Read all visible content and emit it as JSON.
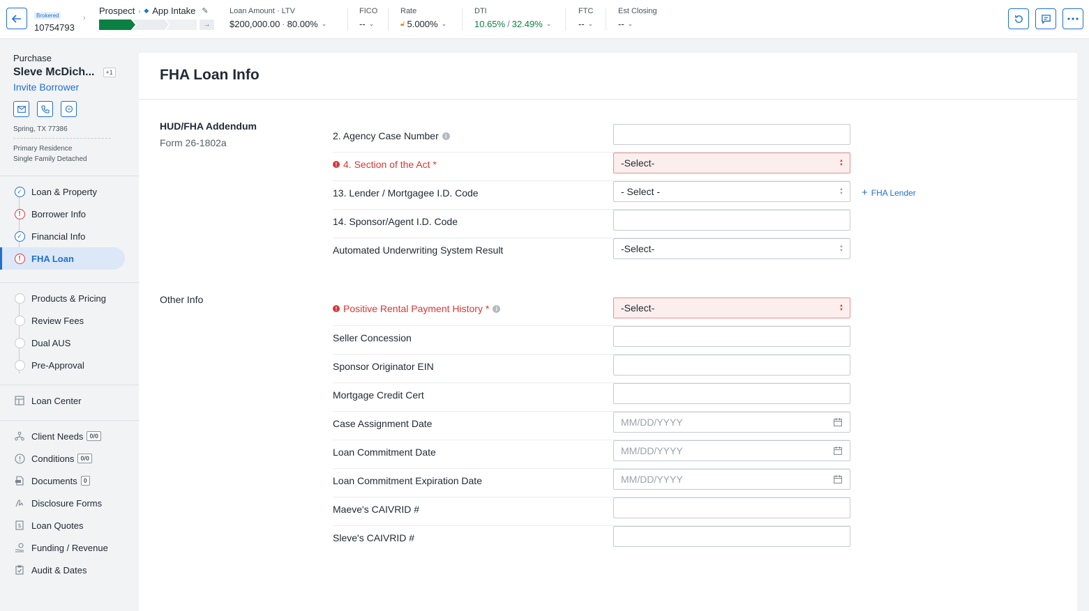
{
  "header": {
    "brokered_label": "Brokered",
    "loan_id": "10754793",
    "stage_prev": "Prospect",
    "stage_current": "App Intake",
    "metrics": {
      "loan_amount_label": "Loan Amount",
      "ltv_label": "LTV",
      "loan_amount": "$200,000.00",
      "ltv": "80.00%",
      "fico_label": "FICO",
      "fico": "--",
      "rate_label": "Rate",
      "rate": "5.000%",
      "dti_label": "DTI",
      "dti_front": "10.65%",
      "dti_back": "32.49%",
      "ftc_label": "FTC",
      "ftc": "--",
      "closing_label": "Est Closing",
      "closing": "--"
    },
    "actions": [
      "refresh-icon",
      "comment-icon",
      "more-icon"
    ],
    "colors": {
      "accent": "#1f6fd1",
      "success": "#0b8043",
      "error": "#d93636",
      "rate_lock": "#e8910c"
    }
  },
  "sidebar": {
    "loan_purpose": "Purchase",
    "borrower_name": "Sleve McDich...",
    "extra_borrowers": "+1",
    "invite_label": "Invite Borrower",
    "address": "Spring, TX 77386",
    "occupancy": "Primary Residence",
    "property_type": "Single Family Detached",
    "steps": [
      {
        "label": "Loan & Property",
        "status": "complete"
      },
      {
        "label": "Borrower Info",
        "status": "error"
      },
      {
        "label": "Financial Info",
        "status": "complete"
      },
      {
        "label": "FHA Loan",
        "status": "error",
        "active": true
      }
    ],
    "next_steps": [
      {
        "label": "Products & Pricing"
      },
      {
        "label": "Review Fees"
      },
      {
        "label": "Dual AUS"
      },
      {
        "label": "Pre-Approval"
      }
    ],
    "loan_center": {
      "label": "Loan Center"
    },
    "tools": [
      {
        "label": "Client Needs",
        "badge": "0/0"
      },
      {
        "label": "Conditions",
        "badge": "0/0"
      },
      {
        "label": "Documents",
        "badge": "0"
      },
      {
        "label": "Disclosure Forms"
      },
      {
        "label": "Loan Quotes"
      },
      {
        "label": "Funding / Revenue"
      },
      {
        "label": "Audit & Dates"
      }
    ]
  },
  "main": {
    "title": "FHA Loan Info",
    "section1": {
      "title": "HUD/FHA Addendum",
      "subtitle": "Form 26-1802a",
      "fields": [
        {
          "label": "2. Agency Case Number",
          "value": "",
          "type": "text",
          "info": true
        },
        {
          "label": "4. Section of the Act *",
          "value": "-Select-",
          "type": "select",
          "required": true,
          "error": true
        },
        {
          "label": "13. Lender / Mortgagee I.D. Code",
          "value": "- Select -",
          "type": "select"
        },
        {
          "label": "14. Sponsor/Agent I.D. Code",
          "value": "",
          "type": "text"
        },
        {
          "label": "Automated Underwriting System Result",
          "value": "-Select-",
          "type": "select"
        }
      ],
      "add_lender_label": "FHA Lender"
    },
    "section2": {
      "title": "Other Info",
      "fields": [
        {
          "label": "Positive Rental Payment History *",
          "value": "-Select-",
          "type": "select",
          "required": true,
          "error": true,
          "info": true
        },
        {
          "label": "Seller Concession",
          "value": "",
          "type": "text"
        },
        {
          "label": "Sponsor Originator EIN",
          "value": "",
          "type": "text"
        },
        {
          "label": "Mortgage Credit Cert",
          "value": "",
          "type": "text"
        },
        {
          "label": "Case Assignment Date",
          "value": "",
          "placeholder": "MM/DD/YYYY",
          "type": "date"
        },
        {
          "label": "Loan Commitment Date",
          "value": "",
          "placeholder": "MM/DD/YYYY",
          "type": "date"
        },
        {
          "label": "Loan Commitment Expiration Date",
          "value": "",
          "placeholder": "MM/DD/YYYY",
          "type": "date"
        },
        {
          "label": "Maeve's CAIVRID #",
          "value": "",
          "type": "text"
        },
        {
          "label": "Sleve's CAIVRID #",
          "value": "",
          "type": "text"
        }
      ]
    }
  }
}
